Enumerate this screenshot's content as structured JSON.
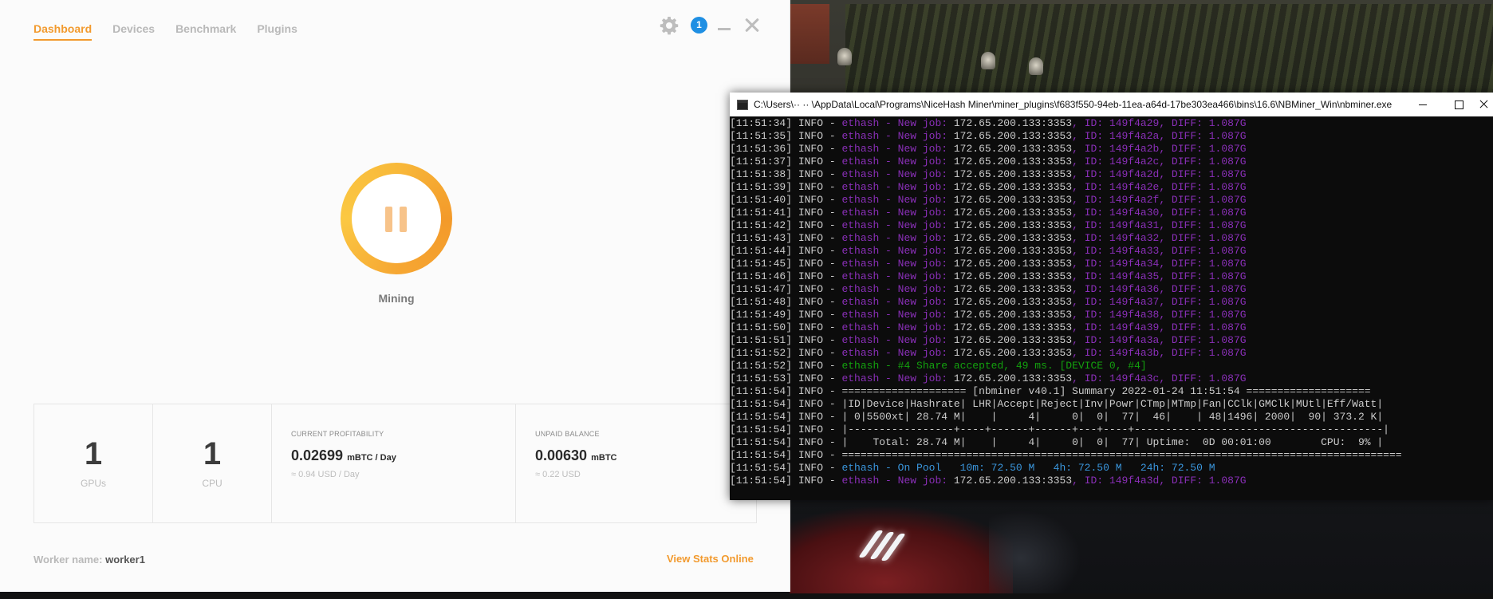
{
  "niceHash": {
    "tabs": [
      {
        "label": "Dashboard",
        "active": true
      },
      {
        "label": "Devices",
        "active": false
      },
      {
        "label": "Benchmark",
        "active": false
      },
      {
        "label": "Plugins",
        "active": false
      }
    ],
    "notification_count": "1",
    "status_label": "Mining",
    "stats": {
      "gpus_count": "1",
      "gpus_label": "GPUs",
      "cpu_count": "1",
      "cpu_label": "CPU",
      "profitability_title": "CURRENT PROFITABILITY",
      "profitability_value": "0.02699",
      "profitability_unit": "mBTC / Day",
      "profitability_usd": "≈ 0.94 USD / Day",
      "balance_title": "UNPAID BALANCE",
      "balance_value": "0.00630",
      "balance_unit": "mBTC",
      "balance_usd": "≈ 0.22 USD"
    },
    "worker_label": "Worker name:",
    "worker_name": "worker1",
    "view_stats_label": "View Stats Online",
    "colors": {
      "accent": "#f29a2e",
      "notification": "#1f8fe3"
    },
    "icons": [
      "gear-icon",
      "notification-badge",
      "minimize-icon",
      "close-icon",
      "pause-icon"
    ]
  },
  "console": {
    "title": "C:\\Users\\·· ·· \\AppData\\Local\\Programs\\NiceHash Miner\\miner_plugins\\f683f550-94eb-11ea-a64d-17be303ea466\\bins\\16.6\\NBMiner_Win\\nbminer.exe",
    "lines": [
      {
        "time": "[11:51:34]",
        "level": " INFO - ",
        "segments": [
          {
            "text": "ethash - New job: ",
            "color": "purple"
          },
          {
            "text": "172.65.200.133:3353",
            "color": "white"
          },
          {
            "text": ", ID: 149f4a29, DIFF: 1.087G",
            "color": "purple"
          }
        ]
      },
      {
        "time": "[11:51:35]",
        "level": " INFO - ",
        "segments": [
          {
            "text": "ethash - New job: ",
            "color": "purple"
          },
          {
            "text": "172.65.200.133:3353",
            "color": "white"
          },
          {
            "text": ", ID: 149f4a2a, DIFF: 1.087G",
            "color": "purple"
          }
        ]
      },
      {
        "time": "[11:51:36]",
        "level": " INFO - ",
        "segments": [
          {
            "text": "ethash - New job: ",
            "color": "purple"
          },
          {
            "text": "172.65.200.133:3353",
            "color": "white"
          },
          {
            "text": ", ID: 149f4a2b, DIFF: 1.087G",
            "color": "purple"
          }
        ]
      },
      {
        "time": "[11:51:37]",
        "level": " INFO - ",
        "segments": [
          {
            "text": "ethash - New job: ",
            "color": "purple"
          },
          {
            "text": "172.65.200.133:3353",
            "color": "white"
          },
          {
            "text": ", ID: 149f4a2c, DIFF: 1.087G",
            "color": "purple"
          }
        ]
      },
      {
        "time": "[11:51:38]",
        "level": " INFO - ",
        "segments": [
          {
            "text": "ethash - New job: ",
            "color": "purple"
          },
          {
            "text": "172.65.200.133:3353",
            "color": "white"
          },
          {
            "text": ", ID: 149f4a2d, DIFF: 1.087G",
            "color": "purple"
          }
        ]
      },
      {
        "time": "[11:51:39]",
        "level": " INFO - ",
        "segments": [
          {
            "text": "ethash - New job: ",
            "color": "purple"
          },
          {
            "text": "172.65.200.133:3353",
            "color": "white"
          },
          {
            "text": ", ID: 149f4a2e, DIFF: 1.087G",
            "color": "purple"
          }
        ]
      },
      {
        "time": "[11:51:40]",
        "level": " INFO - ",
        "segments": [
          {
            "text": "ethash - New job: ",
            "color": "purple"
          },
          {
            "text": "172.65.200.133:3353",
            "color": "white"
          },
          {
            "text": ", ID: 149f4a2f, DIFF: 1.087G",
            "color": "purple"
          }
        ]
      },
      {
        "time": "[11:51:41]",
        "level": " INFO - ",
        "segments": [
          {
            "text": "ethash - New job: ",
            "color": "purple"
          },
          {
            "text": "172.65.200.133:3353",
            "color": "white"
          },
          {
            "text": ", ID: 149f4a30, DIFF: 1.087G",
            "color": "purple"
          }
        ]
      },
      {
        "time": "[11:51:42]",
        "level": " INFO - ",
        "segments": [
          {
            "text": "ethash - New job: ",
            "color": "purple"
          },
          {
            "text": "172.65.200.133:3353",
            "color": "white"
          },
          {
            "text": ", ID: 149f4a31, DIFF: 1.087G",
            "color": "purple"
          }
        ]
      },
      {
        "time": "[11:51:43]",
        "level": " INFO - ",
        "segments": [
          {
            "text": "ethash - New job: ",
            "color": "purple"
          },
          {
            "text": "172.65.200.133:3353",
            "color": "white"
          },
          {
            "text": ", ID: 149f4a32, DIFF: 1.087G",
            "color": "purple"
          }
        ]
      },
      {
        "time": "[11:51:44]",
        "level": " INFO - ",
        "segments": [
          {
            "text": "ethash - New job: ",
            "color": "purple"
          },
          {
            "text": "172.65.200.133:3353",
            "color": "white"
          },
          {
            "text": ", ID: 149f4a33, DIFF: 1.087G",
            "color": "purple"
          }
        ]
      },
      {
        "time": "[11:51:45]",
        "level": " INFO - ",
        "segments": [
          {
            "text": "ethash - New job: ",
            "color": "purple"
          },
          {
            "text": "172.65.200.133:3353",
            "color": "white"
          },
          {
            "text": ", ID: 149f4a34, DIFF: 1.087G",
            "color": "purple"
          }
        ]
      },
      {
        "time": "[11:51:46]",
        "level": " INFO - ",
        "segments": [
          {
            "text": "ethash - New job: ",
            "color": "purple"
          },
          {
            "text": "172.65.200.133:3353",
            "color": "white"
          },
          {
            "text": ", ID: 149f4a35, DIFF: 1.087G",
            "color": "purple"
          }
        ]
      },
      {
        "time": "[11:51:47]",
        "level": " INFO - ",
        "segments": [
          {
            "text": "ethash - New job: ",
            "color": "purple"
          },
          {
            "text": "172.65.200.133:3353",
            "color": "white"
          },
          {
            "text": ", ID: 149f4a36, DIFF: 1.087G",
            "color": "purple"
          }
        ]
      },
      {
        "time": "[11:51:48]",
        "level": " INFO - ",
        "segments": [
          {
            "text": "ethash - New job: ",
            "color": "purple"
          },
          {
            "text": "172.65.200.133:3353",
            "color": "white"
          },
          {
            "text": ", ID: 149f4a37, DIFF: 1.087G",
            "color": "purple"
          }
        ]
      },
      {
        "time": "[11:51:49]",
        "level": " INFO - ",
        "segments": [
          {
            "text": "ethash - New job: ",
            "color": "purple"
          },
          {
            "text": "172.65.200.133:3353",
            "color": "white"
          },
          {
            "text": ", ID: 149f4a38, DIFF: 1.087G",
            "color": "purple"
          }
        ]
      },
      {
        "time": "[11:51:50]",
        "level": " INFO - ",
        "segments": [
          {
            "text": "ethash - New job: ",
            "color": "purple"
          },
          {
            "text": "172.65.200.133:3353",
            "color": "white"
          },
          {
            "text": ", ID: 149f4a39, DIFF: 1.087G",
            "color": "purple"
          }
        ]
      },
      {
        "time": "[11:51:51]",
        "level": " INFO - ",
        "segments": [
          {
            "text": "ethash - New job: ",
            "color": "purple"
          },
          {
            "text": "172.65.200.133:3353",
            "color": "white"
          },
          {
            "text": ", ID: 149f4a3a, DIFF: 1.087G",
            "color": "purple"
          }
        ]
      },
      {
        "time": "[11:51:52]",
        "level": " INFO - ",
        "segments": [
          {
            "text": "ethash - New job: ",
            "color": "purple"
          },
          {
            "text": "172.65.200.133:3353",
            "color": "white"
          },
          {
            "text": ", ID: 149f4a3b, DIFF: 1.087G",
            "color": "purple"
          }
        ]
      },
      {
        "time": "[11:51:52]",
        "level": " INFO - ",
        "segments": [
          {
            "text": "ethash - #4 Share accepted, 49 ms. [DEVICE 0, #4]",
            "color": "green"
          }
        ]
      },
      {
        "time": "[11:51:53]",
        "level": " INFO - ",
        "segments": [
          {
            "text": "ethash - New job: ",
            "color": "purple"
          },
          {
            "text": "172.65.200.133:3353",
            "color": "white"
          },
          {
            "text": ", ID: 149f4a3c, DIFF: 1.087G",
            "color": "purple"
          }
        ]
      },
      {
        "time": "[11:51:54]",
        "level": " INFO - ",
        "segments": [
          {
            "text": "==================== [nbminer v40.1] Summary 2022-01-24 11:51:54 ====================",
            "color": "white"
          }
        ]
      },
      {
        "time": "[11:51:54]",
        "level": " INFO - ",
        "segments": [
          {
            "text": "|ID|Device|Hashrate| LHR|Accept|Reject|Inv|Powr|CTmp|MTmp|Fan|CClk|GMClk|MUtl|Eff/Watt|",
            "color": "white"
          }
        ]
      },
      {
        "time": "[11:51:54]",
        "level": " INFO - ",
        "segments": [
          {
            "text": "| 0|5500xt| 28.74 M|    |     4|     0|  0|  77|  46|    | 48|1496| 2000|  90| 373.2 K|",
            "color": "white"
          }
        ]
      },
      {
        "time": "[11:51:54]",
        "level": " INFO - ",
        "segments": [
          {
            "text": "|-----------------+----+------+------+---+----+----------------------------------------|",
            "color": "white"
          }
        ]
      },
      {
        "time": "[11:51:54]",
        "level": " INFO - ",
        "segments": [
          {
            "text": "|    Total: 28.74 M|    |     4|     0|  0|  77| Uptime:  0D 00:01:00        CPU:  9% |",
            "color": "white"
          }
        ]
      },
      {
        "time": "[11:51:54]",
        "level": " INFO - ",
        "segments": [
          {
            "text": "==========================================================================================",
            "color": "white"
          }
        ]
      },
      {
        "time": "[11:51:54]",
        "level": " INFO - ",
        "segments": [
          {
            "text": "ethash - On Pool   10m: 72.50 M   4h: 72.50 M   24h: 72.50 M",
            "color": "blue"
          }
        ]
      },
      {
        "time": "[11:51:54]",
        "level": " INFO - ",
        "segments": [
          {
            "text": "ethash - New job: ",
            "color": "purple"
          },
          {
            "text": "172.65.200.133:3353",
            "color": "white"
          },
          {
            "text": ", ID: 149f4a3d, DIFF: 1.087G",
            "color": "purple"
          }
        ]
      }
    ]
  }
}
